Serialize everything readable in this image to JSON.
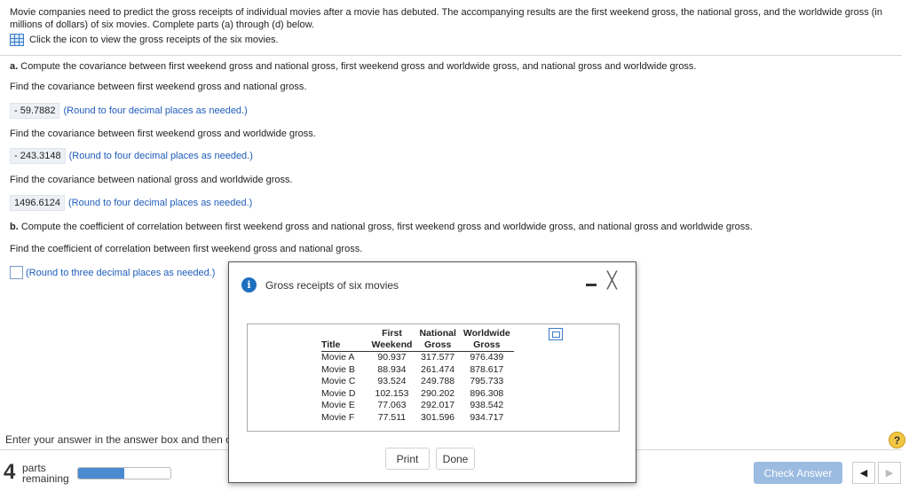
{
  "intro": {
    "text": "Movie companies need to predict the gross receipts of individual movies after a movie has debuted. The accompanying results are the first weekend gross, the national gross, and the worldwide gross (in millions of dollars) of six movies. Complete parts (a) through (d) below.",
    "icon_link": "Click the icon to view the gross receipts of the six movies."
  },
  "part_a": {
    "label": "a.",
    "prompt": " Compute the covariance between first weekend gross and national gross, first weekend gross and worldwide gross, and national gross and worldwide gross.",
    "q1": "Find the covariance between first weekend gross and national gross.",
    "a1": "- 59.7882",
    "h1": "(Round to four decimal places as needed.)",
    "q2": "Find the covariance between first weekend gross and worldwide gross.",
    "a2": "- 243.3148",
    "h2": "(Round to four decimal places as needed.)",
    "q3": "Find the covariance between national gross and worldwide gross.",
    "a3": "1496.6124",
    "h3": "(Round to four decimal places as needed.)"
  },
  "part_b": {
    "label": "b.",
    "prompt": " Compute the coefficient of correlation between first weekend gross and national gross, first weekend gross and worldwide gross, and national gross and worldwide gross.",
    "q1": "Find the coefficient of correlation between first weekend gross and national gross.",
    "h1": "(Round to three decimal places as needed.)"
  },
  "footer": {
    "instruction": "Enter your answer in the answer box and then c",
    "parts_count": "4",
    "parts_label_1": "parts",
    "parts_label_2": "remaining",
    "progress_fraction": 0.5,
    "check_answer": "Check Answer",
    "help": "?"
  },
  "modal": {
    "title": "Gross receipts of six movies",
    "info_icon": "i",
    "columns": [
      {
        "line1": "",
        "line2": "Title"
      },
      {
        "line1": "First",
        "line2": "Weekend"
      },
      {
        "line1": "National",
        "line2": "Gross"
      },
      {
        "line1": "Worldwide",
        "line2": "Gross"
      }
    ],
    "rows": [
      [
        "Movie A",
        "90.937",
        "317.577",
        "976.439"
      ],
      [
        "Movie B",
        "88.934",
        "261.474",
        "878.617"
      ],
      [
        "Movie C",
        "93.524",
        "249.788",
        "795.733"
      ],
      [
        "Movie D",
        "102.153",
        "290.202",
        "896.308"
      ],
      [
        "Movie E",
        "77.063",
        "292.017",
        "938.542"
      ],
      [
        "Movie F",
        "77.511",
        "301.596",
        "934.717"
      ]
    ],
    "print_label": "Print",
    "done_label": "Done"
  }
}
